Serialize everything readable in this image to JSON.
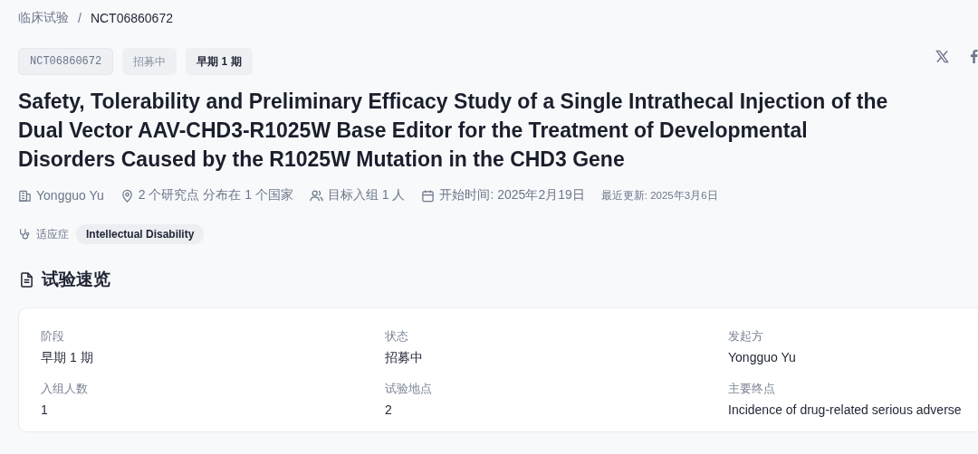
{
  "breadcrumb": {
    "parent": "临床试验",
    "separator": "/",
    "current": "NCT06860672"
  },
  "badges": [
    {
      "label": "NCT06860672",
      "kind": "id"
    },
    {
      "label": "招募中",
      "kind": "status"
    },
    {
      "label": "早期 1 期",
      "kind": "phase"
    }
  ],
  "share": [
    {
      "kind": "x"
    },
    {
      "kind": "facebook"
    }
  ],
  "title": "Safety, Tolerability and Preliminary Efficacy Study of a Single Intrathecal Injection of the Dual Vector AAV-CHD3-R1025W Base Editor for the Treatment of Developmental Disorders Caused by the R1025W Mutation in the CHD3 Gene",
  "meta": [
    {
      "kind": "sponsor",
      "text": "Yongguo Yu"
    },
    {
      "kind": "sites",
      "text": "2 个研究点 分布在 1 个国家"
    },
    {
      "kind": "enrollment",
      "text": "目标入组 1 人"
    },
    {
      "kind": "start",
      "text": "开始时间: 2025年2月19日"
    },
    {
      "kind": "updated",
      "text": "最近更新: 2025年3月6日"
    }
  ],
  "indication": {
    "label": "适应症",
    "tags": [
      "Intellectual Disability"
    ]
  },
  "section": {
    "title": "试验速览"
  },
  "overview": [
    {
      "label": "阶段",
      "value": "早期 1 期"
    },
    {
      "label": "状态",
      "value": "招募中"
    },
    {
      "label": "发起方",
      "value": "Yongguo Yu"
    },
    {
      "label": "入组人数",
      "value": "1"
    },
    {
      "label": "试验地点",
      "value": "2"
    },
    {
      "label": "主要终点",
      "value": "Incidence of drug-related serious adverse"
    }
  ]
}
